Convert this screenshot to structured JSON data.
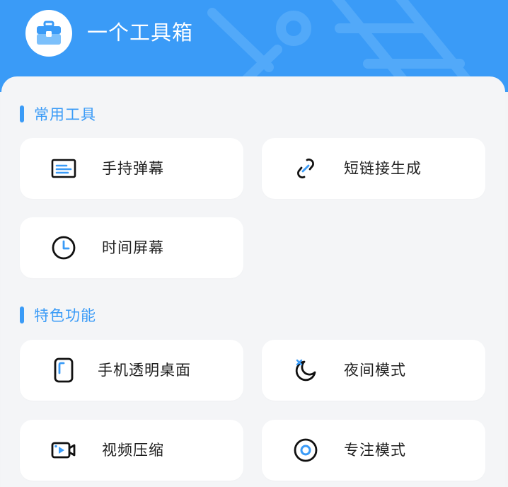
{
  "app": {
    "title": "一个工具箱",
    "accent": "#3a9bf7",
    "logo_icon": "toolbox-icon"
  },
  "sections": [
    {
      "title": "常用工具",
      "items": [
        {
          "label": "手持弹幕",
          "icon": "danmaku-screen-icon"
        },
        {
          "label": "短链接生成",
          "icon": "link-icon"
        },
        {
          "label": "时间屏幕",
          "icon": "clock-icon"
        }
      ]
    },
    {
      "title": "特色功能",
      "items": [
        {
          "label": "手机透明桌面",
          "icon": "phone-icon"
        },
        {
          "label": "夜间模式",
          "icon": "moon-icon"
        },
        {
          "label": "视频压缩",
          "icon": "video-camera-icon"
        },
        {
          "label": "专注模式",
          "icon": "target-icon"
        }
      ]
    }
  ]
}
